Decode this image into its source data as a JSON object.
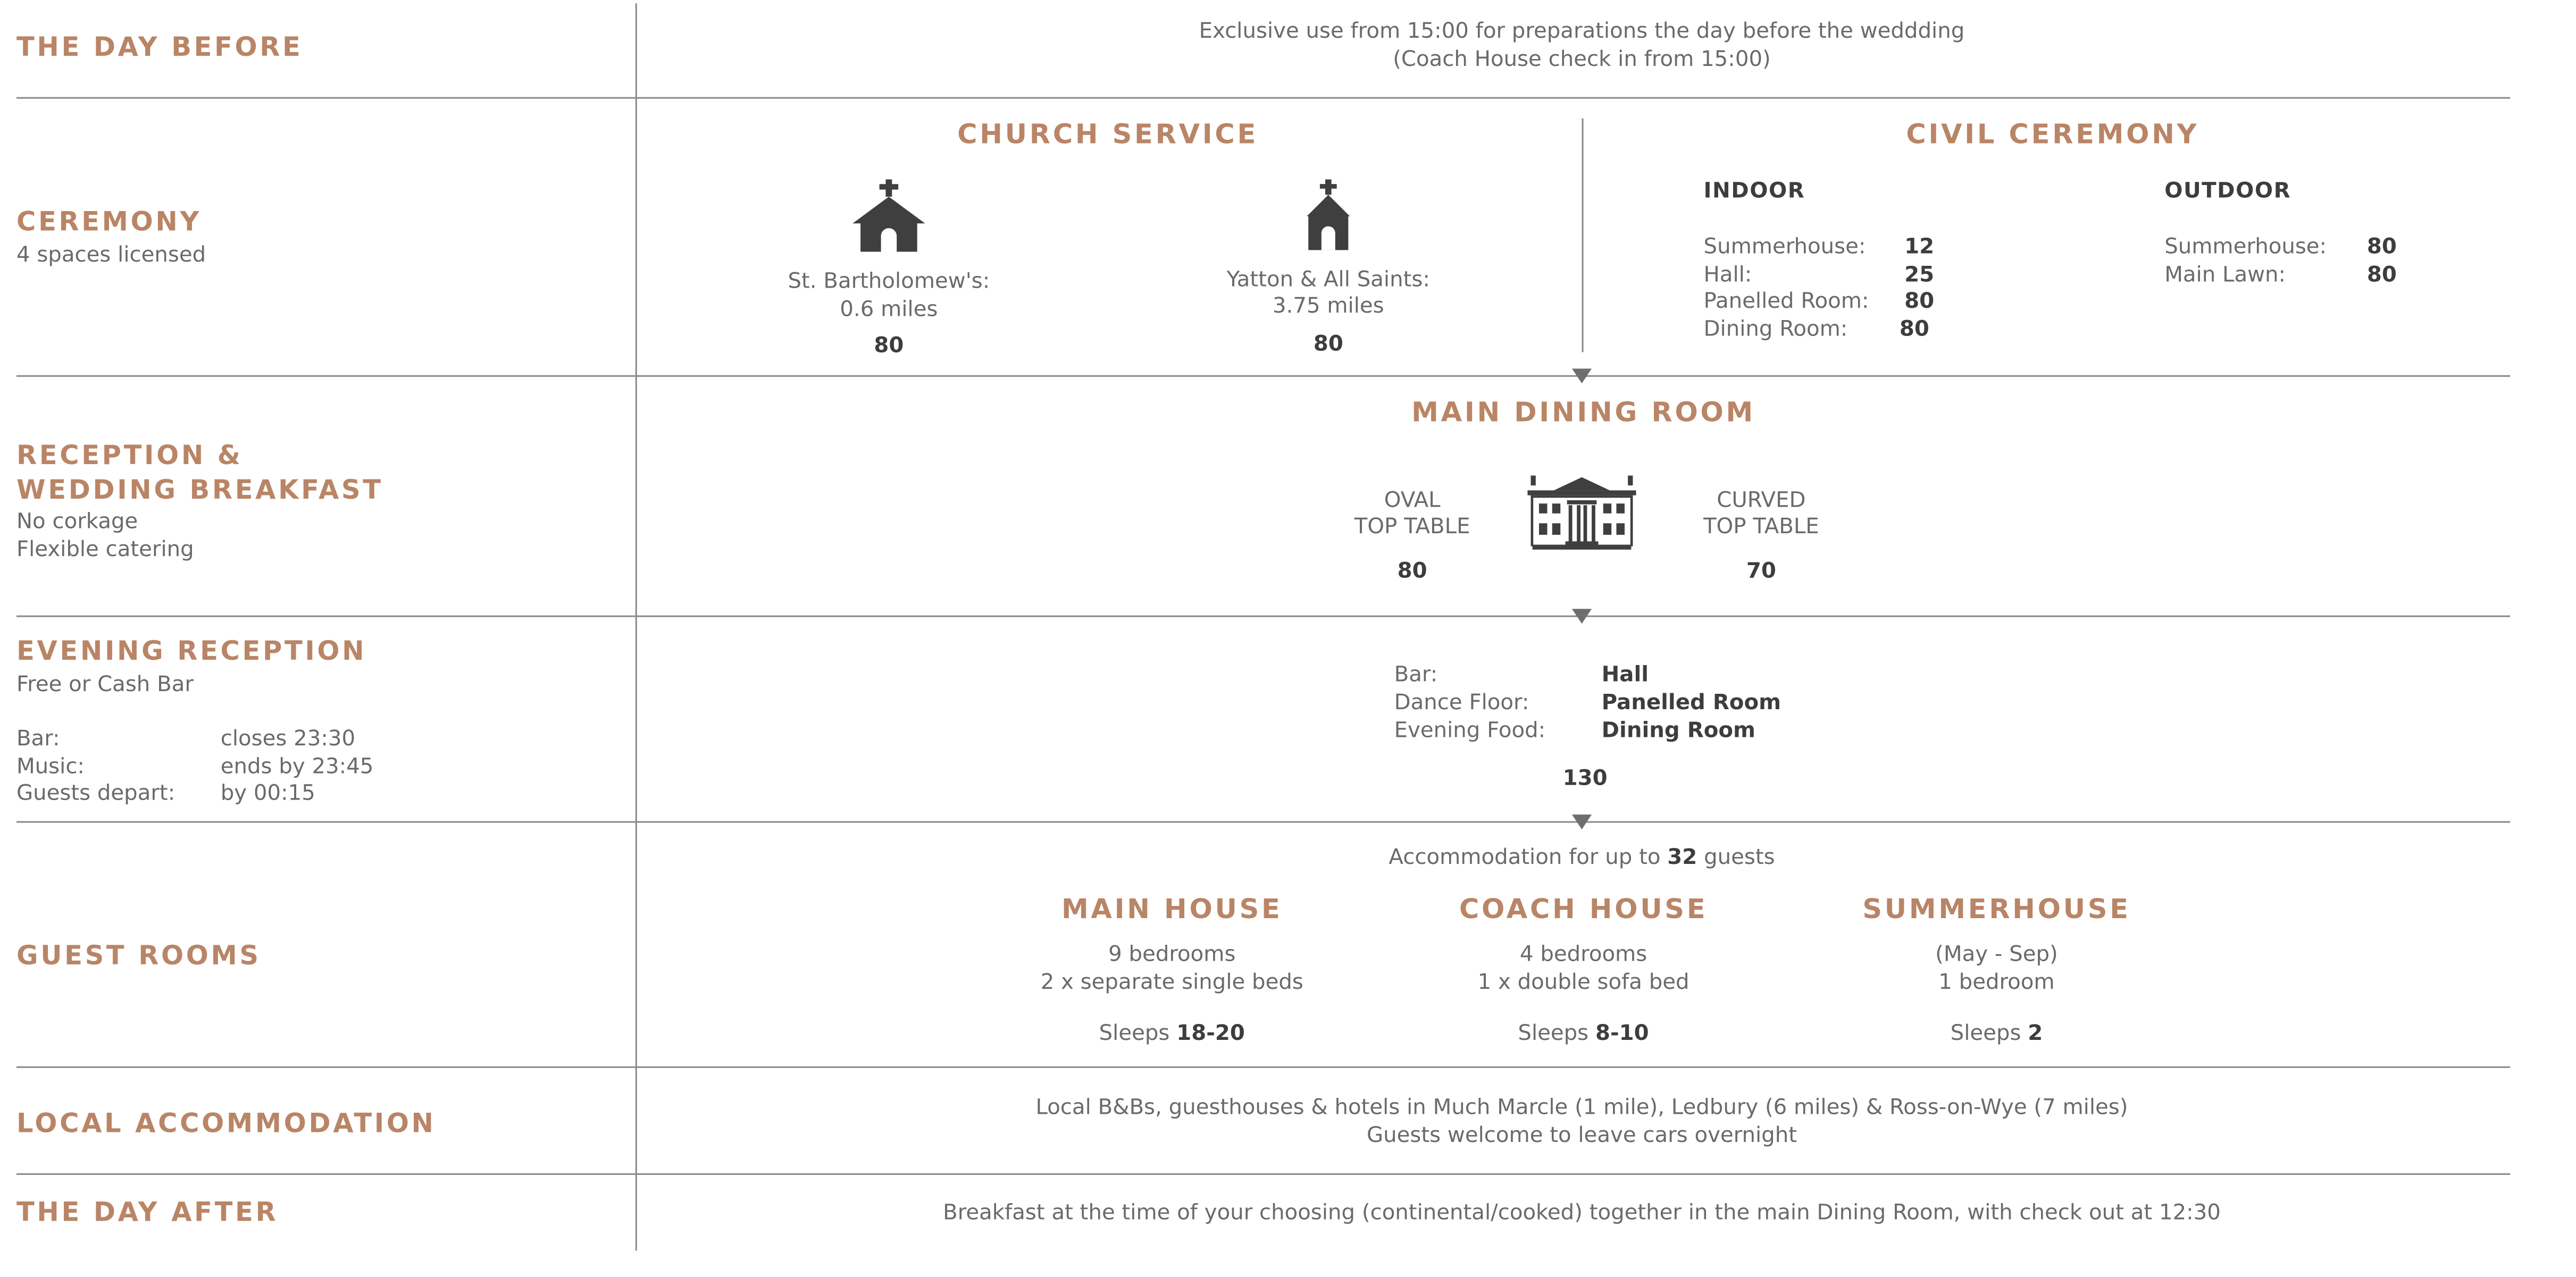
{
  "day_before": {
    "title": "THE DAY BEFORE",
    "line1": "Exclusive use from 15:00 for preparations the day before the weddding",
    "line2": "(Coach House check in from 15:00)"
  },
  "ceremony": {
    "title": "CEREMONY",
    "subtitle": "4 spaces licensed",
    "church": {
      "heading": "CHURCH SERVICE",
      "venues": [
        {
          "icon": "church-icon",
          "name": "St. Bartholomew's:",
          "distance": "0.6 miles",
          "capacity": "80"
        },
        {
          "icon": "church-icon",
          "name": "Yatton & All Saints:",
          "distance": "3.75 miles",
          "capacity": "80"
        }
      ]
    },
    "civil": {
      "heading": "CIVIL CEREMONY",
      "indoor": {
        "heading": "INDOOR",
        "rows": [
          {
            "label": "Summerhouse:",
            "value": "12"
          },
          {
            "label": "Hall:",
            "value": "25"
          },
          {
            "label": "Panelled Room:",
            "value": "80"
          },
          {
            "label": "Dining Room:",
            "value": "80"
          }
        ]
      },
      "outdoor": {
        "heading": "OUTDOOR",
        "rows": [
          {
            "label": "Summerhouse:",
            "value": "80"
          },
          {
            "label": "Main Lawn:",
            "value": "80"
          }
        ]
      }
    }
  },
  "reception": {
    "title_line1": "RECEPTION &",
    "title_line2": "WEDDING BREAKFAST",
    "sub1": "No corkage",
    "sub2": "Flexible catering",
    "heading": "MAIN DINING ROOM",
    "oval": {
      "line1": "OVAL",
      "line2": "TOP TABLE",
      "capacity": "80"
    },
    "curved": {
      "line1": "CURVED",
      "line2": "TOP TABLE",
      "capacity": "70"
    }
  },
  "evening": {
    "title": "EVENING RECEPTION",
    "subtitle": "Free or Cash Bar",
    "times": [
      {
        "label": "Bar:",
        "value": "closes 23:30"
      },
      {
        "label": "Music:",
        "value": "ends by 23:45"
      },
      {
        "label": "Guests depart:",
        "value": "by 00:15"
      }
    ],
    "locations": [
      {
        "label": "Bar:",
        "value": "Hall"
      },
      {
        "label": "Dance Floor:",
        "value": "Panelled Room"
      },
      {
        "label": "Evening Food:",
        "value": "Dining Room"
      }
    ],
    "capacity": "130"
  },
  "guest_rooms": {
    "title": "GUEST ROOMS",
    "intro_before": "Accommodation for up to ",
    "intro_number": "32",
    "intro_after": " guests",
    "houses": [
      {
        "name": "MAIN HOUSE",
        "line1": "9 bedrooms",
        "line2": "2 x separate single beds",
        "sleeps_label": "Sleeps ",
        "sleeps": "18-20"
      },
      {
        "name": "COACH HOUSE",
        "line1": "4 bedrooms",
        "line2": "1 x double sofa bed",
        "sleeps_label": "Sleeps ",
        "sleeps": "8-10"
      },
      {
        "name": "SUMMERHOUSE",
        "line1": "(May - Sep)",
        "line2": "1 bedroom",
        "sleeps_label": "Sleeps ",
        "sleeps": "2"
      }
    ]
  },
  "local": {
    "title": "LOCAL ACCOMMODATION",
    "line1": "Local B&Bs, guesthouses & hotels in Much Marcle (1 mile), Ledbury (6 miles) & Ross-on-Wye (7 miles)",
    "line2": "Guests welcome to leave cars overnight"
  },
  "day_after": {
    "title": "THE DAY AFTER",
    "line1": "Breakfast at the time of your choosing (continental/cooked) together in the main Dining Room, with check out at 12:30"
  },
  "colors": {
    "accent": "#b98566",
    "text": "#6a6a6a",
    "bold": "#3d3d3d",
    "icon": "#3f3f3f",
    "rule": "#8c8c8c"
  }
}
